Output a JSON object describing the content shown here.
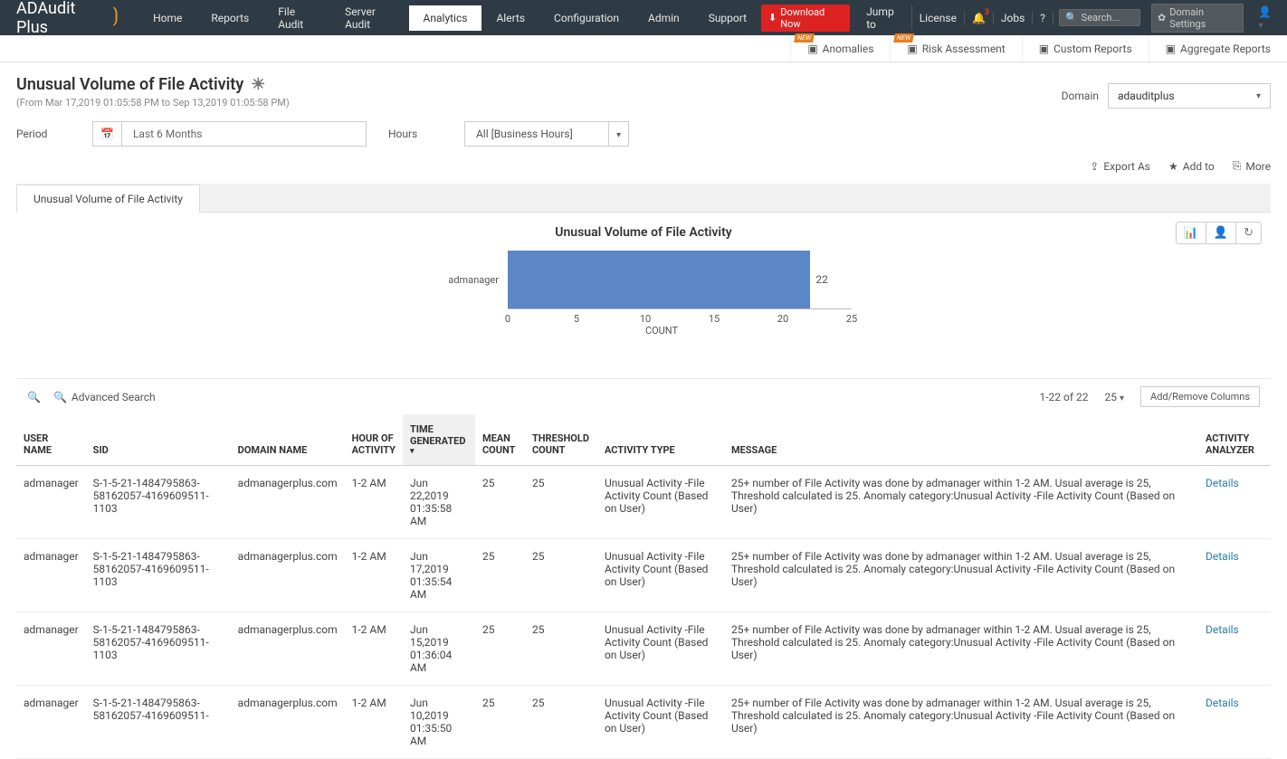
{
  "brand": {
    "name": "ADAudit Plus"
  },
  "topnav": {
    "items": [
      "Home",
      "Reports",
      "File Audit",
      "Server Audit",
      "Analytics",
      "Alerts",
      "Configuration",
      "Admin",
      "Support"
    ],
    "active": 4
  },
  "topright": {
    "download": "Download Now",
    "jump": "Jump to",
    "license": "License",
    "jobs": "Jobs",
    "notif_count": "3",
    "search_placeholder": "Search...",
    "domain_settings": "Domain Settings"
  },
  "subnav": {
    "items": [
      {
        "label": "Anomalies",
        "new": true
      },
      {
        "label": "Risk Assessment",
        "new": true
      },
      {
        "label": "Custom Reports",
        "new": false
      },
      {
        "label": "Aggregate Reports",
        "new": false
      }
    ]
  },
  "page": {
    "title": "Unusual Volume of File Activity",
    "range": "(From Mar 17,2019 01:05:58 PM to Sep 13,2019 01:05:58 PM)",
    "domain_label": "Domain",
    "domain_value": "adauditplus"
  },
  "filters": {
    "period_label": "Period",
    "period_value": "Last 6 Months",
    "hours_label": "Hours",
    "hours_value": "All [Business Hours]"
  },
  "actions": {
    "export": "Export As",
    "addto": "Add to",
    "more": "More"
  },
  "tab": "Unusual Volume of File Activity",
  "chart_data": {
    "type": "bar",
    "orientation": "horizontal",
    "title": "Unusual Volume of File Activity",
    "categories": [
      "admanager"
    ],
    "values": [
      22
    ],
    "xlabel": "COUNT",
    "xlim": [
      0,
      25
    ],
    "xticks": [
      0,
      5,
      10,
      15,
      20,
      25
    ]
  },
  "table": {
    "search_label": "Advanced Search",
    "page_info": "1-22 of 22",
    "page_size": "25",
    "add_remove": "Add/Remove Columns",
    "details": "Details",
    "columns": [
      "USER NAME",
      "SID",
      "DOMAIN NAME",
      "HOUR OF ACTIVITY",
      "TIME GENERATED",
      "MEAN COUNT",
      "THRESHOLD COUNT",
      "ACTIVITY TYPE",
      "MESSAGE",
      "ACTIVITY ANALYZER"
    ],
    "sorted_col": 4,
    "rows": [
      {
        "user": "admanager",
        "sid": "S-1-5-21-1484795863-58162057-4169609511-1103",
        "domain": "admanagerplus.com",
        "hour": "1-2 AM",
        "time": "Jun 22,2019 01:35:58 AM",
        "mean": "25",
        "thr": "25",
        "type": "Unusual Activity -File Activity Count (Based on User)",
        "msg": "25+ number of File Activity was done by admanager within 1-2 AM. Usual average is 25, Threshold calculated is 25. Anomaly category:Unusual Activity -File Activity Count (Based on User)"
      },
      {
        "user": "admanager",
        "sid": "S-1-5-21-1484795863-58162057-4169609511-1103",
        "domain": "admanagerplus.com",
        "hour": "1-2 AM",
        "time": "Jun 17,2019 01:35:54 AM",
        "mean": "25",
        "thr": "25",
        "type": "Unusual Activity -File Activity Count (Based on User)",
        "msg": "25+ number of File Activity was done by admanager within 1-2 AM. Usual average is 25, Threshold calculated is 25. Anomaly category:Unusual Activity -File Activity Count (Based on User)"
      },
      {
        "user": "admanager",
        "sid": "S-1-5-21-1484795863-58162057-4169609511-1103",
        "domain": "admanagerplus.com",
        "hour": "1-2 AM",
        "time": "Jun 15,2019 01:36:04 AM",
        "mean": "25",
        "thr": "25",
        "type": "Unusual Activity -File Activity Count (Based on User)",
        "msg": "25+ number of File Activity was done by admanager within 1-2 AM. Usual average is 25, Threshold calculated is 25. Anomaly category:Unusual Activity -File Activity Count (Based on User)"
      },
      {
        "user": "admanager",
        "sid": "S-1-5-21-1484795863-58162057-4169609511-",
        "domain": "admanagerplus.com",
        "hour": "1-2 AM",
        "time": "Jun 10,2019 01:35:50 AM",
        "mean": "25",
        "thr": "25",
        "type": "Unusual Activity -File Activity Count (Based on User)",
        "msg": "25+ number of File Activity was done by admanager within 1-2 AM. Usual average is 25, Threshold calculated is 25. Anomaly category:Unusual Activity -File Activity Count (Based on User)"
      }
    ]
  }
}
